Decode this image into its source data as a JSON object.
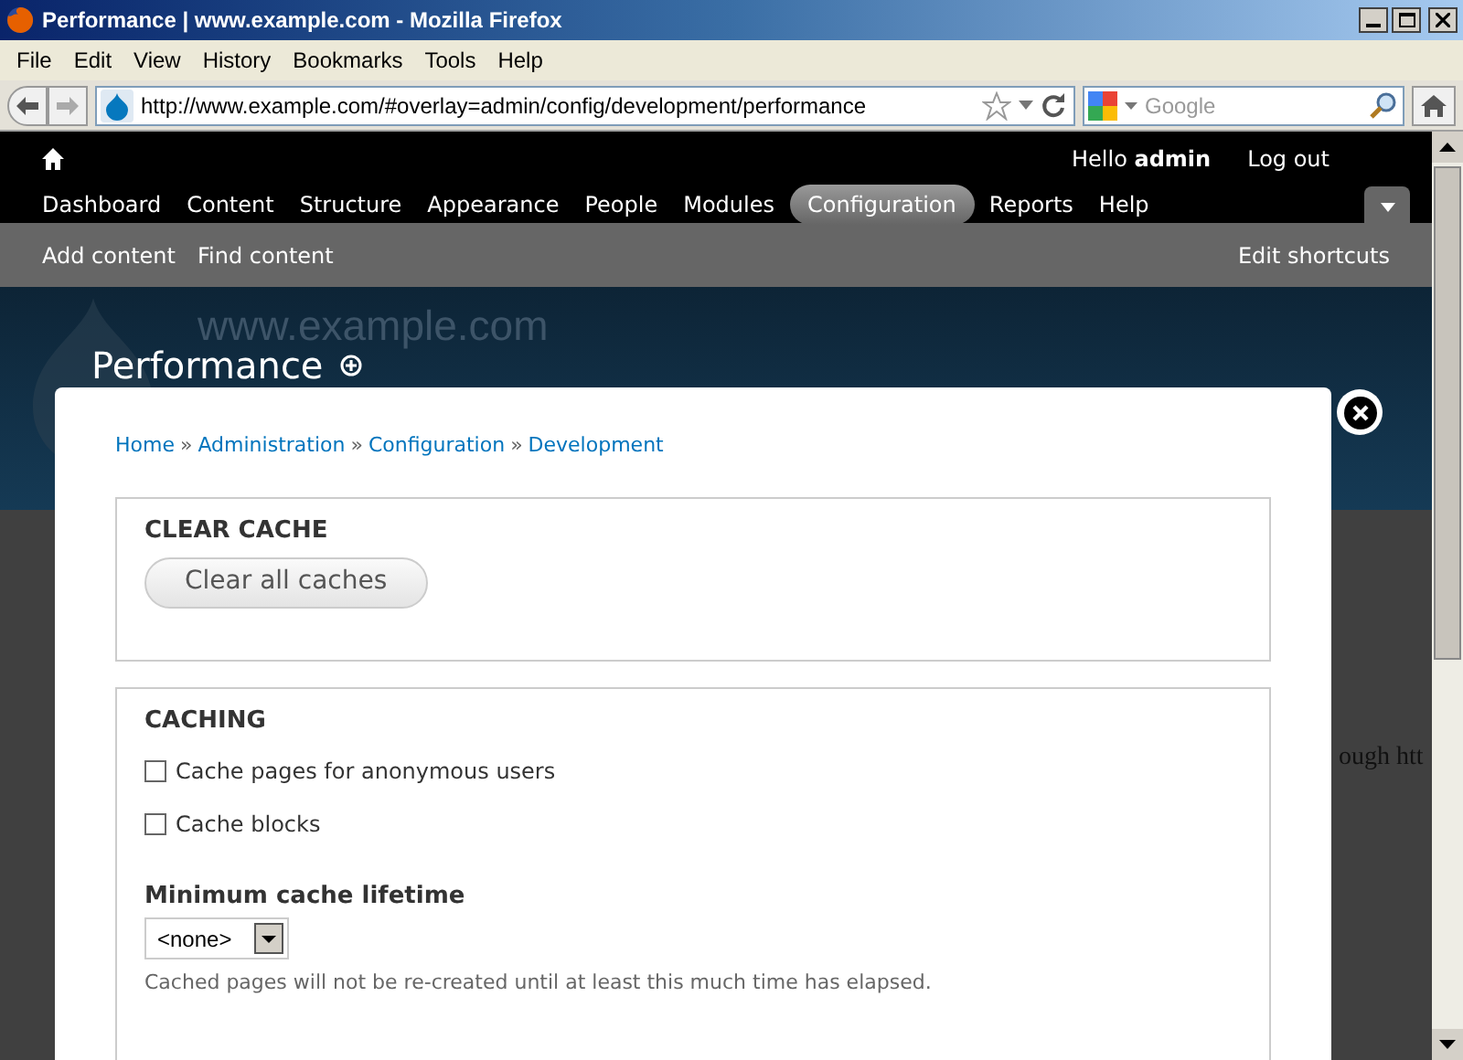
{
  "window": {
    "title": "Performance | www.example.com - Mozilla Firefox"
  },
  "menu_bar": [
    "File",
    "Edit",
    "View",
    "History",
    "Bookmarks",
    "Tools",
    "Help"
  ],
  "navigation": {
    "url": "http://www.example.com/#overlay=admin/config/development/performance",
    "search_placeholder": "Google"
  },
  "toolbar": {
    "items": [
      {
        "label": "Dashboard",
        "selected": false
      },
      {
        "label": "Content",
        "selected": false
      },
      {
        "label": "Structure",
        "selected": false
      },
      {
        "label": "Appearance",
        "selected": false
      },
      {
        "label": "People",
        "selected": false
      },
      {
        "label": "Modules",
        "selected": false
      },
      {
        "label": "Configuration",
        "selected": true
      },
      {
        "label": "Reports",
        "selected": false
      },
      {
        "label": "Help",
        "selected": false
      }
    ],
    "greeting": "Hello **admin**",
    "logout": "Log out"
  },
  "shortcuts": {
    "items": [
      "Add content",
      "Find content"
    ],
    "edit": "Edit shortcuts"
  },
  "header": {
    "site_name": "www.example.com",
    "page_title": "Performance"
  },
  "background_text": "ough htt",
  "overlay": {
    "breadcrumb": [
      "Home",
      "Administration",
      "Configuration",
      "Development"
    ],
    "breadcrumb_separator": "»",
    "clear_cache": {
      "legend": "CLEAR CACHE",
      "button": "Clear all caches"
    },
    "caching": {
      "legend": "CACHING",
      "checkboxes": [
        {
          "label": "Cache pages for anonymous users",
          "checked": false
        },
        {
          "label": "Cache blocks",
          "checked": false
        }
      ],
      "select_label": "Minimum cache lifetime",
      "select_value": "<none>",
      "description": "Cached pages will not be re-created until at least this much time has elapsed."
    }
  }
}
